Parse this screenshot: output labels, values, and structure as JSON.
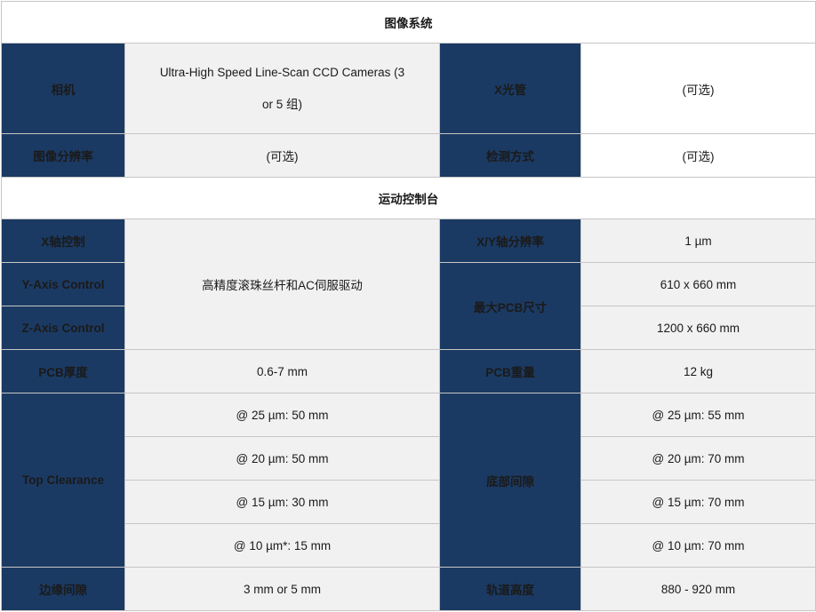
{
  "colors": {
    "label_bg": "#1b3a63",
    "label_text": "#ffffff",
    "value_bg_grey": "#f1f1f1",
    "value_bg_white": "#ffffff",
    "border": "#c6c6c6",
    "page_bg": "#ffffff"
  },
  "sections": [
    {
      "id": "imaging-system",
      "title": "图像系统",
      "rows": [
        {
          "label_left": "相机",
          "value_left": "Ultra-High Speed Line-Scan CCD Cameras (3 or 5 组)",
          "label_right": "X光管",
          "value_right": "(可选)"
        },
        {
          "label_left": "图像分辨率",
          "value_left": "(可选)",
          "label_right": "检测方式",
          "value_right": "(可选)"
        }
      ]
    },
    {
      "id": "motion-control-stage",
      "title": "运动控制台",
      "rows": [
        {
          "label_left": "X轴控制",
          "value_left": "高精度滚珠丝杆和AC伺服驱动",
          "label_right": "X/Y轴分辨率",
          "value_right": "1 µm"
        },
        {
          "label_left": "Y-Axis Control",
          "label_right": "最大PCB尺寸",
          "value_right": "610 x 660 mm"
        },
        {
          "label_left": "Z-Axis Control",
          "value_right": "1200 x 660 mm"
        },
        {
          "label_left": "PCB厚度",
          "value_left": "0.6-7 mm",
          "label_right": "PCB重量",
          "value_right": "12 kg"
        },
        {
          "label_left": "Top Clearance",
          "value_left": "@ 25 µm: 50 mm",
          "label_right": "底部间隙",
          "value_right": "@ 25 µm: 55 mm"
        },
        {
          "value_left": "@ 20 µm: 50 mm",
          "value_right": "@ 20 µm: 70 mm"
        },
        {
          "value_left": "@ 15 µm: 30 mm",
          "value_right": "@ 15 µm: 70 mm"
        },
        {
          "value_left": "@ 10 µm*: 15 mm",
          "value_right": "@ 10 µm: 70 mm"
        },
        {
          "label_left": "边缘间隙",
          "value_left": "3 mm or 5 mm",
          "label_right": "轨道高度",
          "value_right": "880 - 920 mm"
        }
      ]
    }
  ],
  "imaging": {
    "title": "图像系统",
    "camera_label": "相机",
    "camera_value_line1": "Ultra-High Speed Line-Scan CCD Cameras (3",
    "camera_value_line2": "or 5 组)",
    "xray_tube_label": "X光管",
    "xray_tube_value": "(可选)",
    "image_resolution_label": "图像分辨率",
    "image_resolution_value": "(可选)",
    "inspection_mode_label": "检测方式",
    "inspection_mode_value": "(可选)"
  },
  "motion": {
    "title": "运动控制台",
    "x_axis_control_label": "X轴控制",
    "y_axis_control_label": "Y-Axis Control",
    "z_axis_control_label": "Z-Axis Control",
    "drive_value": "高精度滚珠丝杆和AC伺服驱动",
    "xy_resolution_label": "X/Y轴分辨率",
    "xy_resolution_value": "1 µm",
    "max_pcb_size_label": "最大PCB尺寸",
    "max_pcb_size_value_1": "610 x 660 mm",
    "max_pcb_size_value_2": "1200 x 660 mm",
    "pcb_thickness_label": "PCB厚度",
    "pcb_thickness_value": "0.6-7 mm",
    "pcb_weight_label": "PCB重量",
    "pcb_weight_value": "12 kg",
    "top_clearance_label": "Top Clearance",
    "top_clearance_1": "@ 25 µm: 50 mm",
    "top_clearance_2": "@ 20 µm: 50 mm",
    "top_clearance_3": "@ 15 µm: 30 mm",
    "top_clearance_4": "@ 10 µm*: 15 mm",
    "bottom_clearance_label": "底部间隙",
    "bottom_clearance_1": "@ 25 µm: 55 mm",
    "bottom_clearance_2": "@ 20 µm: 70 mm",
    "bottom_clearance_3": "@ 15 µm: 70 mm",
    "bottom_clearance_4": "@ 10 µm: 70 mm",
    "edge_clearance_label": "边缘间隙",
    "edge_clearance_value": "3 mm or 5 mm",
    "rail_height_label": "轨道高度",
    "rail_height_value": "880 - 920 mm"
  }
}
